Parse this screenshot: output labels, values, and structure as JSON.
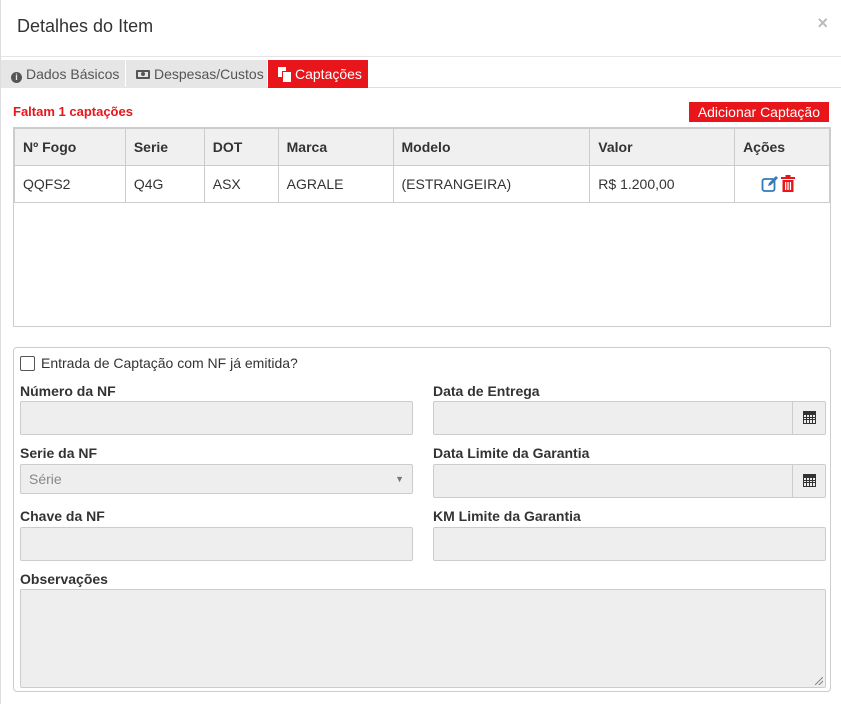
{
  "modal": {
    "title": "Detalhes do Item",
    "close_label": "×"
  },
  "tabs": [
    {
      "label": "Dados Básicos",
      "icon": "info-circle-icon"
    },
    {
      "label": "Despesas/Custos",
      "icon": "money-icon"
    },
    {
      "label": "Captações",
      "icon": "copy-icon"
    }
  ],
  "captacoes": {
    "warning": "Faltam 1 captações",
    "add_button": "Adicionar Captação",
    "columns": [
      "Nº Fogo",
      "Serie",
      "DOT",
      "Marca",
      "Modelo",
      "Valor",
      "Ações"
    ],
    "rows": [
      {
        "fogo": "QQFS2",
        "serie": "Q4G",
        "dot": "ASX",
        "marca": "AGRALE",
        "modelo": "(ESTRANGEIRA)",
        "valor": "R$ 1.200,00"
      }
    ]
  },
  "form": {
    "nf_checkbox_label": "Entrada de Captação com NF já emitida?",
    "numero_nf_label": "Número da NF",
    "data_entrega_label": "Data de Entrega",
    "serie_nf_label": "Serie da NF",
    "serie_placeholder": "Série",
    "data_limite_label": "Data Limite da Garantia",
    "chave_nf_label": "Chave da NF",
    "km_limite_label": "KM Limite da Garantia",
    "observacoes_label": "Observações"
  },
  "colors": {
    "accent": "#e8161a",
    "edit_icon": "#337ab7"
  }
}
